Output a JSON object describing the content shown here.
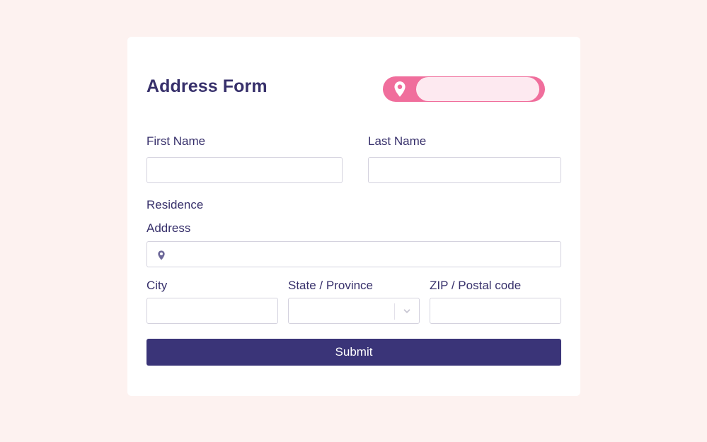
{
  "form": {
    "title": "Address Form",
    "first_name_label": "First Name",
    "first_name_value": "",
    "last_name_label": "Last Name",
    "last_name_value": "",
    "residence_label": "Residence",
    "address_label": "Address",
    "address_value": "",
    "city_label": "City",
    "city_value": "",
    "state_label": "State / Province",
    "state_value": "",
    "zip_label": "ZIP / Postal code",
    "zip_value": "",
    "submit_label": "Submit"
  },
  "icons": {
    "toggle_icon": "map-pin-icon",
    "address_icon": "map-pin-icon",
    "state_dropdown_icon": "chevron-down-icon"
  },
  "colors": {
    "page_background": "#fdf2f0",
    "card_background": "#ffffff",
    "accent_pink": "#f06e9c",
    "toggle_track": "#fde9f0",
    "text_primary": "#37306b",
    "button_background": "#3a3478",
    "input_border": "#d4d2de"
  }
}
